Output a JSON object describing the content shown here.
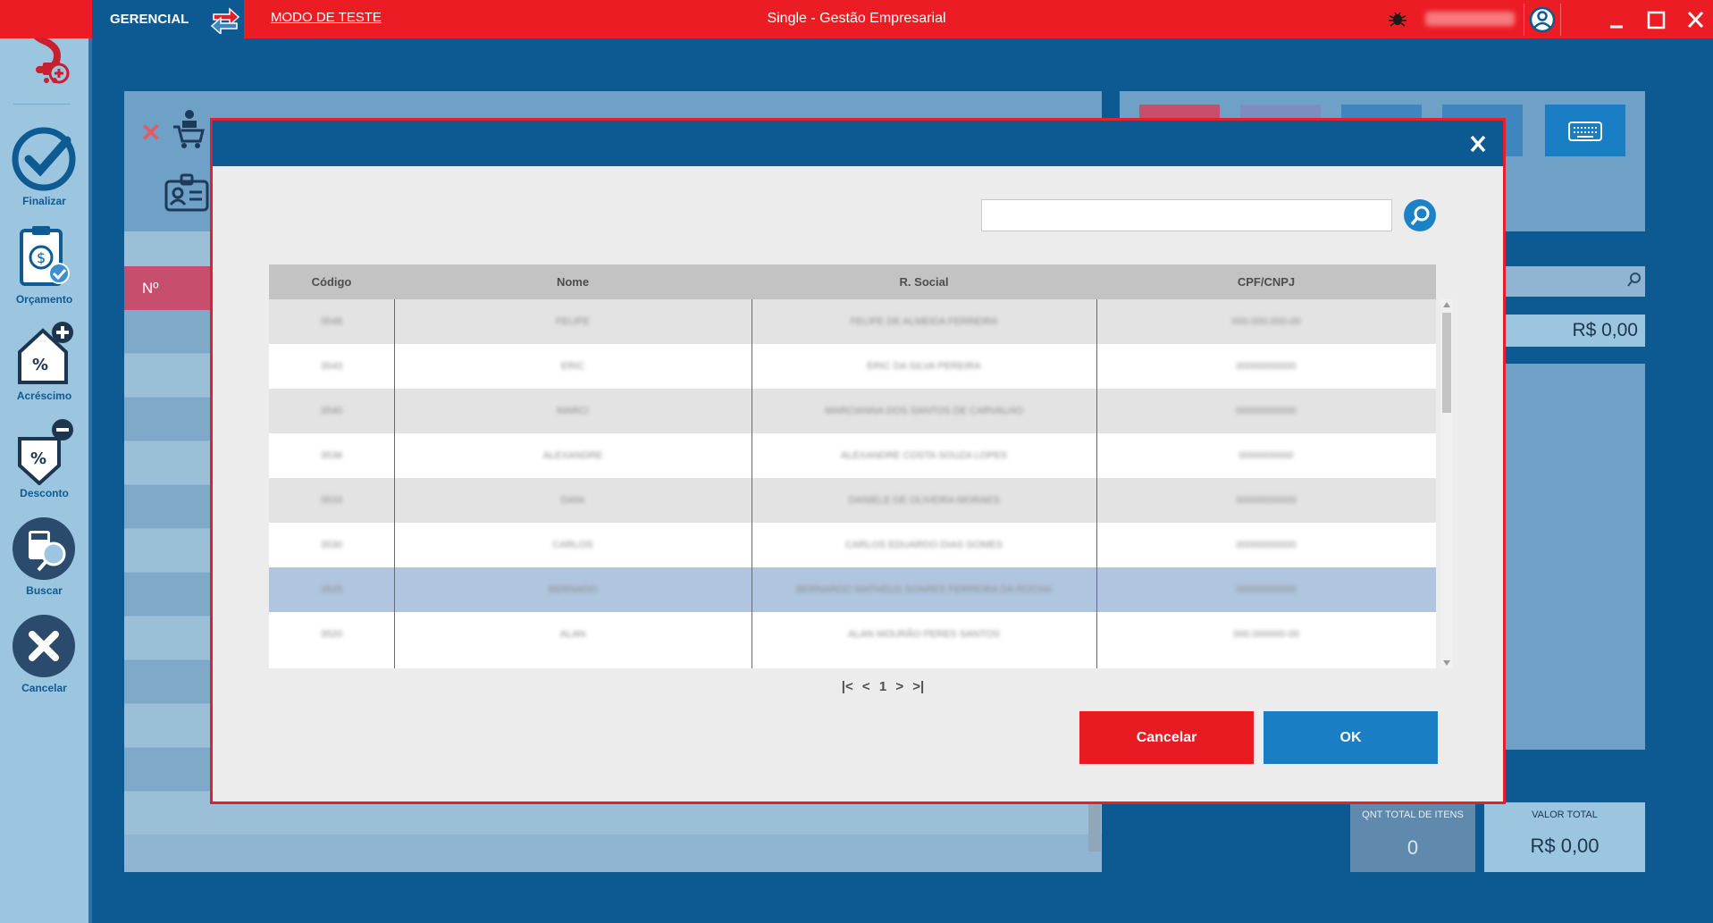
{
  "app": {
    "brand_label": "GERENCIAL",
    "test_mode_link": "MODO DE TESTE",
    "window_title": "Single - Gestão Empresarial",
    "brand_color": "#ec1c24",
    "primary_color": "#0d5a93"
  },
  "sidebar": {
    "items": [
      {
        "label": "Finalizar",
        "icon": "check-circle-icon"
      },
      {
        "label": "Orçamento",
        "icon": "budget-clipboard-icon"
      },
      {
        "label": "Acréscimo",
        "icon": "house-plus-icon"
      },
      {
        "label": "Desconto",
        "icon": "discount-tag-icon"
      },
      {
        "label": "Buscar",
        "icon": "search-calculator-icon"
      },
      {
        "label": "Cancelar",
        "icon": "x-circle-icon"
      }
    ]
  },
  "background": {
    "number_header": "Nº",
    "unit_price": "R$ 0,00",
    "qnt_total_label": "QNT TOTAL DE ITENS",
    "qnt_total_value": "0",
    "valor_total_label": "VALOR TOTAL",
    "valor_total_value": "R$ 0,00"
  },
  "modal": {
    "search_value": "",
    "columns": [
      "Código",
      "Nome",
      "R. Social",
      "CPF/CNPJ"
    ],
    "rows": [
      {
        "codigo": "3548",
        "nome": "FELIPE",
        "rsocial": "FELIPE DE ALMEIDA FERREIRA",
        "cpf": "000.000.000-00",
        "selected": false
      },
      {
        "codigo": "3543",
        "nome": "ERIC",
        "rsocial": "ERIC DA SILVA PEREIRA",
        "cpf": "00000000000",
        "selected": false
      },
      {
        "codigo": "3540",
        "nome": "MARCI",
        "rsocial": "MARCIANNA DOS SANTOS DE CARVALHO",
        "cpf": "00000000000",
        "selected": false
      },
      {
        "codigo": "3536",
        "nome": "ALEXANDRE",
        "rsocial": "ALEXANDRE COSTA SOUZA LOPES",
        "cpf": "0000000000",
        "selected": false
      },
      {
        "codigo": "3533",
        "nome": "DANI",
        "rsocial": "DANIELE DE OLIVEIRA MORAES",
        "cpf": "00000000000",
        "selected": false
      },
      {
        "codigo": "3530",
        "nome": "CARLOS",
        "rsocial": "CARLOS EDUARDO DIAS GOMES",
        "cpf": "00000000000",
        "selected": false
      },
      {
        "codigo": "3525",
        "nome": "BERNADO",
        "rsocial": "BERNARDO MATHEUS SOARES FERREIRA DA ROCHA",
        "cpf": "00000000000",
        "selected": true
      },
      {
        "codigo": "3520",
        "nome": "ALAN",
        "rsocial": "ALAN MOURÃO PERES SANTOS",
        "cpf": "000.000000-00",
        "selected": false
      }
    ],
    "pager": {
      "first": "|<",
      "prev": "<",
      "page": "1",
      "next": ">",
      "last": ">|"
    },
    "cancel_label": "Cancelar",
    "ok_label": "OK"
  }
}
